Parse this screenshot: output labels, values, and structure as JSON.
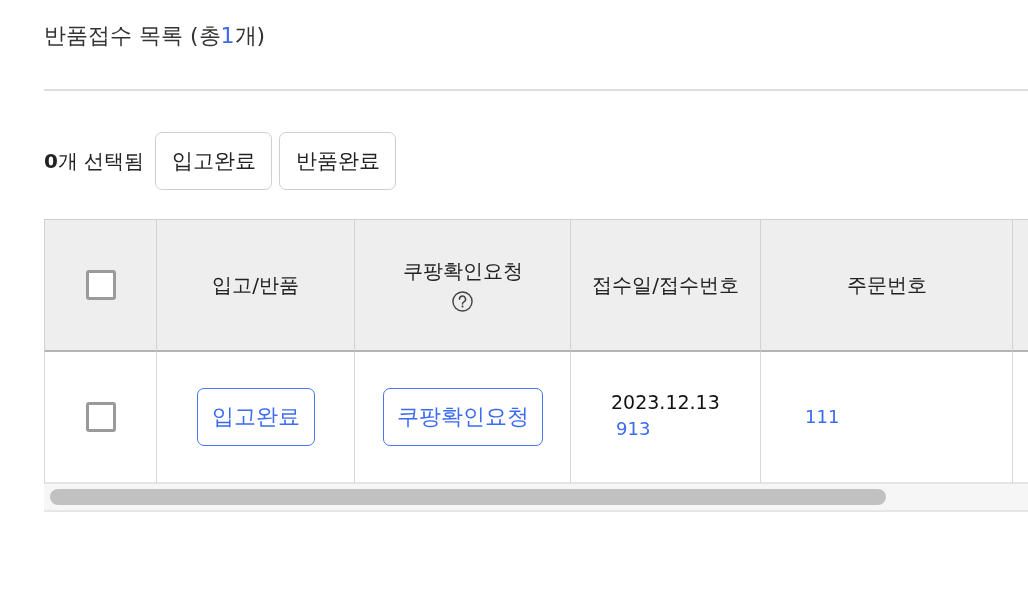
{
  "header": {
    "title": "반품접수 목록",
    "total": {
      "before": "(총",
      "count": "1",
      "after": "개)"
    }
  },
  "selection_bar": {
    "status": "**0**개 선택됨",
    "buttons": [
      "입고완료",
      "반품완료"
    ]
  },
  "table": {
    "columns": [
      {
        "kind": "checkbox",
        "checked": false
      },
      {
        "kind": "text",
        "label": "입고/반품"
      },
      {
        "kind": "help",
        "label": "쿠팡확인요청"
      },
      {
        "kind": "text",
        "label": "접수일/접수번호"
      },
      {
        "kind": "text",
        "label": "주문번호"
      }
    ],
    "rows": [
      {
        "checked": false,
        "receipt_button": "입고완료",
        "confirm_button": "쿠팡확인요청",
        "date": "2023.12.13",
        "receipt_no": "913",
        "order_no": "111"
      }
    ]
  }
}
